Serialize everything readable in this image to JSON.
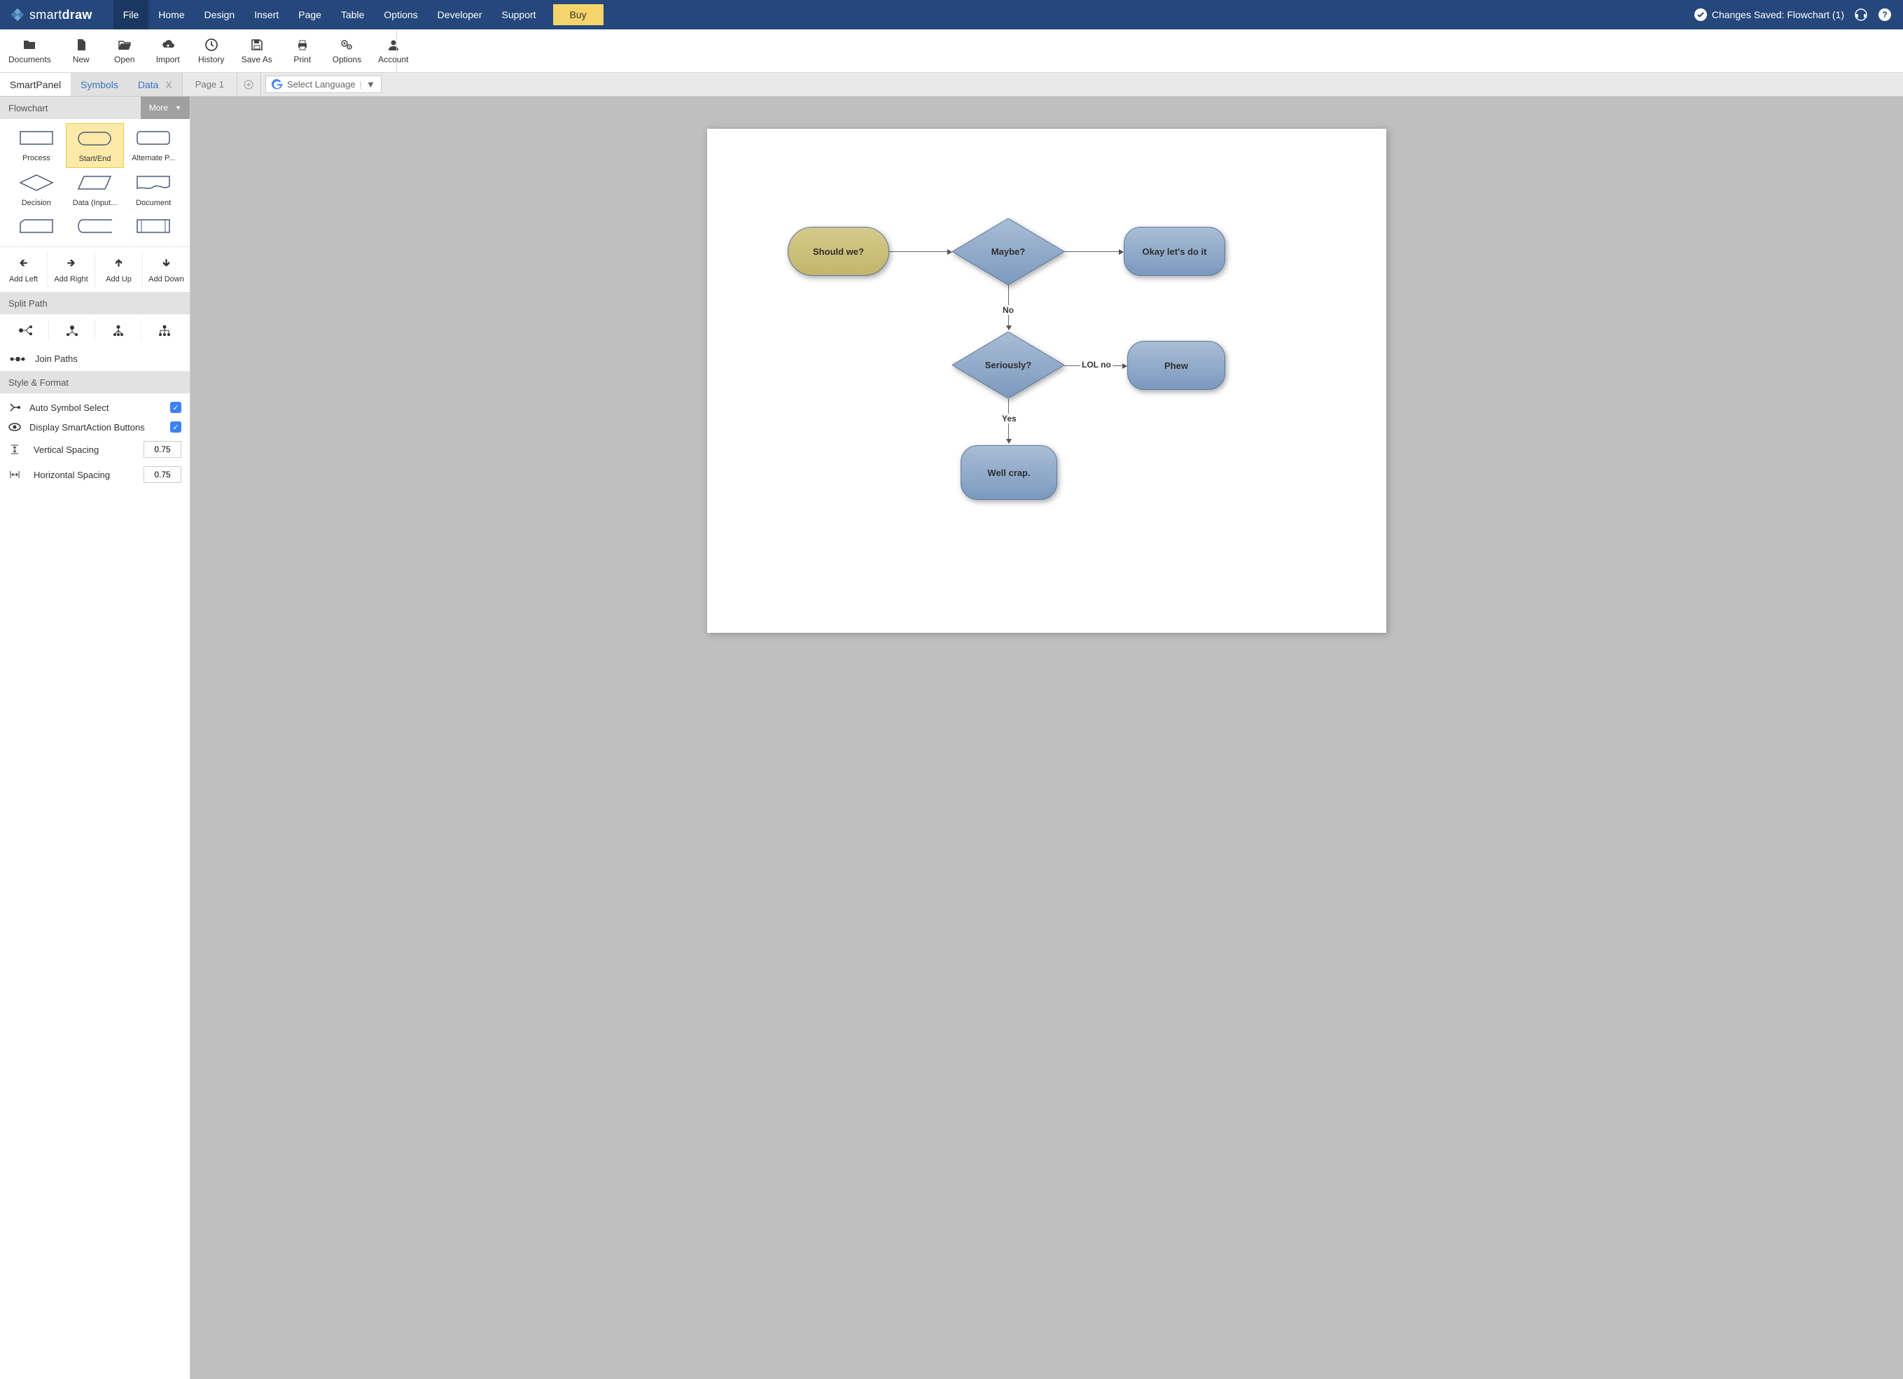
{
  "brand": {
    "name1": "smart",
    "name2": "draw"
  },
  "menu": {
    "items": [
      "File",
      "Home",
      "Design",
      "Insert",
      "Page",
      "Table",
      "Options",
      "Developer",
      "Support"
    ],
    "active": "File",
    "buy": "Buy"
  },
  "status": {
    "saved": "Changes Saved: Flowchart (1)"
  },
  "toolbar": [
    {
      "label": "Documents",
      "icon": "folder"
    },
    {
      "label": "New",
      "icon": "file"
    },
    {
      "label": "Open",
      "icon": "open"
    },
    {
      "label": "Import",
      "icon": "cloud"
    },
    {
      "label": "History",
      "icon": "clock"
    },
    {
      "label": "Save As",
      "icon": "save"
    },
    {
      "label": "Print",
      "icon": "print"
    },
    {
      "label": "Options",
      "icon": "gears"
    },
    {
      "label": "Account",
      "icon": "user"
    }
  ],
  "tabs": {
    "smartpanel": "SmartPanel",
    "symbols": "Symbols",
    "data": "Data",
    "page": "Page 1"
  },
  "lang_select": "Select Language",
  "sidebar": {
    "library_name": "Flowchart",
    "more": "More",
    "shapes": [
      {
        "label": "Process",
        "kind": "rect"
      },
      {
        "label": "Start/End",
        "kind": "terminator",
        "selected": true
      },
      {
        "label": "Alternate P...",
        "kind": "roundrect"
      },
      {
        "label": "Decision",
        "kind": "diamond"
      },
      {
        "label": "Data (Input...",
        "kind": "parallelogram"
      },
      {
        "label": "Document",
        "kind": "document"
      },
      {
        "label": "",
        "kind": "card"
      },
      {
        "label": "",
        "kind": "stored"
      },
      {
        "label": "",
        "kind": "subprocess"
      }
    ],
    "add": [
      "Add Left",
      "Add Right",
      "Add Up",
      "Add Down"
    ],
    "split_header": "Split Path",
    "join": "Join Paths",
    "style_header": "Style & Format",
    "opts": {
      "auto_symbol": "Auto Symbol Select",
      "smart_action": "Display SmartAction Buttons",
      "vspacing_label": "Vertical Spacing",
      "vspacing_value": "0.75",
      "hspacing_label": "Horizontal Spacing",
      "hspacing_value": "0.75"
    }
  },
  "flowchart": {
    "n1": "Should we?",
    "n2": "Maybe?",
    "n3": "Okay let's do it",
    "n4": "Seriously?",
    "n5": "Phew",
    "n6": "Well crap.",
    "e_no": "No",
    "e_lol": "LOL no",
    "e_yes": "Yes"
  }
}
